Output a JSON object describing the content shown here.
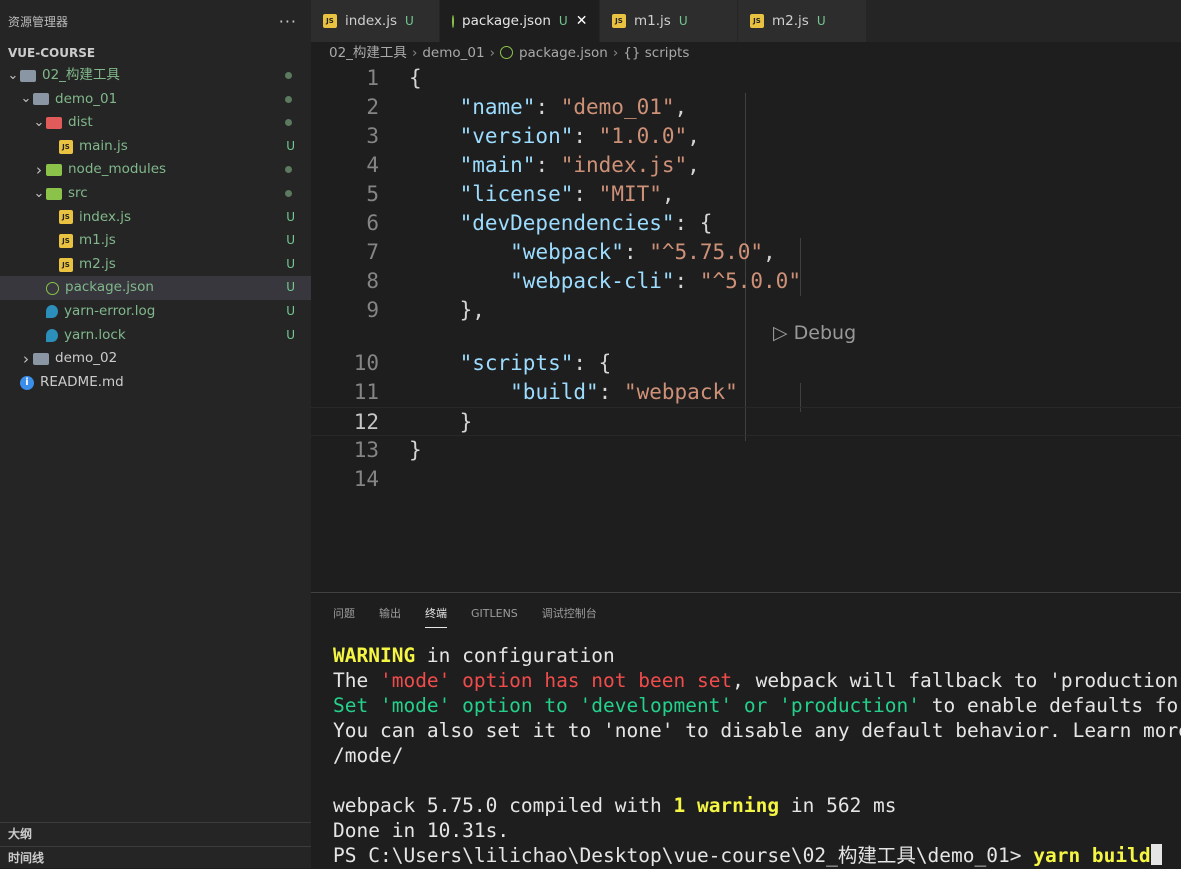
{
  "explorer": {
    "title": "资源管理器",
    "more": "···",
    "section": "VUE-COURSE",
    "items": [
      {
        "name": "02_构建工具",
        "depth": 0,
        "type": "folder",
        "open": true,
        "status": "dot"
      },
      {
        "name": "demo_01",
        "depth": 1,
        "type": "folder",
        "open": true,
        "status": "dot"
      },
      {
        "name": "dist",
        "depth": 2,
        "type": "folder-red",
        "open": true,
        "status": "dot"
      },
      {
        "name": "main.js",
        "depth": 3,
        "type": "js",
        "status": "U"
      },
      {
        "name": "node_modules",
        "depth": 2,
        "type": "folder-green",
        "open": false,
        "status": "dot"
      },
      {
        "name": "src",
        "depth": 2,
        "type": "folder-green",
        "open": true,
        "status": "dot"
      },
      {
        "name": "index.js",
        "depth": 3,
        "type": "js",
        "status": "U"
      },
      {
        "name": "m1.js",
        "depth": 3,
        "type": "js",
        "status": "U"
      },
      {
        "name": "m2.js",
        "depth": 3,
        "type": "js",
        "status": "U"
      },
      {
        "name": "package.json",
        "depth": 2,
        "type": "json",
        "status": "U",
        "selected": true
      },
      {
        "name": "yarn-error.log",
        "depth": 2,
        "type": "yarn",
        "status": "U"
      },
      {
        "name": "yarn.lock",
        "depth": 2,
        "type": "yarn",
        "status": "U"
      },
      {
        "name": "demo_02",
        "depth": 1,
        "type": "folder",
        "open": false,
        "status": ""
      },
      {
        "name": "README.md",
        "depth": 0,
        "type": "info",
        "status": ""
      }
    ],
    "outline": "大纲",
    "timeline": "时间线"
  },
  "tabs": [
    {
      "label": "index.js",
      "icon": "js",
      "status": "U",
      "active": false
    },
    {
      "label": "package.json",
      "icon": "json",
      "status": "U",
      "active": true,
      "close": "✕"
    },
    {
      "label": "m1.js",
      "icon": "js",
      "status": "U",
      "active": false
    },
    {
      "label": "m2.js",
      "icon": "js",
      "status": "U",
      "active": false
    }
  ],
  "breadcrumb": [
    "02_构建工具",
    "demo_01",
    "package.json",
    "{} scripts"
  ],
  "code": {
    "current_line": 12,
    "lines": [
      [
        [
          "p",
          "{"
        ]
      ],
      [
        [
          "p",
          "    "
        ],
        [
          "k",
          "\"name\""
        ],
        [
          "p",
          ": "
        ],
        [
          "s",
          "\"demo_01\""
        ],
        [
          "p",
          ","
        ]
      ],
      [
        [
          "p",
          "    "
        ],
        [
          "k",
          "\"version\""
        ],
        [
          "p",
          ": "
        ],
        [
          "s",
          "\"1.0.0\""
        ],
        [
          "p",
          ","
        ]
      ],
      [
        [
          "p",
          "    "
        ],
        [
          "k",
          "\"main\""
        ],
        [
          "p",
          ": "
        ],
        [
          "s",
          "\"index.js\""
        ],
        [
          "p",
          ","
        ]
      ],
      [
        [
          "p",
          "    "
        ],
        [
          "k",
          "\"license\""
        ],
        [
          "p",
          ": "
        ],
        [
          "s",
          "\"MIT\""
        ],
        [
          "p",
          ","
        ]
      ],
      [
        [
          "p",
          "    "
        ],
        [
          "k",
          "\"devDependencies\""
        ],
        [
          "p",
          ": {"
        ]
      ],
      [
        [
          "p",
          "        "
        ],
        [
          "k",
          "\"webpack\""
        ],
        [
          "p",
          ": "
        ],
        [
          "s",
          "\"^5.75.0\""
        ],
        [
          "p",
          ","
        ]
      ],
      [
        [
          "p",
          "        "
        ],
        [
          "k",
          "\"webpack-cli\""
        ],
        [
          "p",
          ": "
        ],
        [
          "s",
          "\"^5.0.0\""
        ]
      ],
      [
        [
          "p",
          "    },"
        ]
      ],
      [
        [
          "p",
          "    "
        ],
        [
          "k",
          "\"scripts\""
        ],
        [
          "p",
          ": {"
        ]
      ],
      [
        [
          "p",
          "        "
        ],
        [
          "k",
          "\"build\""
        ],
        [
          "p",
          ": "
        ],
        [
          "s",
          "\"webpack\""
        ]
      ],
      [
        [
          "p",
          "    }"
        ]
      ],
      [
        [
          "p",
          "}"
        ]
      ],
      [
        [
          "p",
          ""
        ]
      ]
    ],
    "codelens": "▷ Debug"
  },
  "panel": {
    "tabs": [
      "问题",
      "输出",
      "终端",
      "GITLENS",
      "调试控制台"
    ],
    "active_tab": 2,
    "terminal": [
      [
        [
          "y",
          "WARNING"
        ],
        [
          "n",
          " in configuration"
        ]
      ],
      [
        [
          "n",
          "The "
        ],
        [
          "r",
          "'mode' option has not been set"
        ],
        [
          "n",
          ", webpack will fallback to 'production'"
        ]
      ],
      [
        [
          "g",
          "Set 'mode' option to 'development' or 'production'"
        ],
        [
          "n",
          " to enable defaults for"
        ]
      ],
      [
        [
          "n",
          "You can also set it to 'none' to disable any default behavior. Learn more"
        ]
      ],
      [
        [
          "n",
          "/mode/"
        ]
      ],
      [
        [
          "n",
          ""
        ]
      ],
      [
        [
          "n",
          "webpack 5.75.0 compiled with "
        ],
        [
          "y",
          "1 warning"
        ],
        [
          "n",
          " in 562 ms"
        ]
      ],
      [
        [
          "n",
          "Done in 10.31s."
        ]
      ],
      [
        [
          "n",
          "PS C:\\Users\\lilichao\\Desktop\\vue-course\\02_构建工具\\demo_01> "
        ],
        [
          "y",
          "yarn build"
        ]
      ]
    ]
  }
}
